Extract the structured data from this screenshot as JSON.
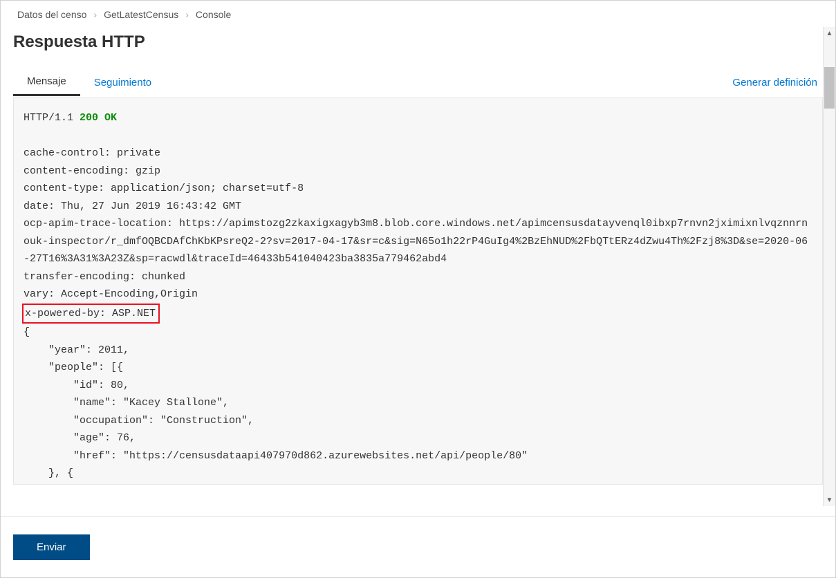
{
  "breadcrumb": {
    "item1": "Datos del censo",
    "item2": "GetLatestCensus",
    "item3": "Console"
  },
  "pageTitle": "Respuesta HTTP",
  "tabs": {
    "message": "Mensaje",
    "tracking": "Seguimiento",
    "generate": "Generar definición"
  },
  "response": {
    "protocol": "HTTP/1.1",
    "status": "200 OK",
    "headers": {
      "cacheControl": "cache-control: private",
      "contentEncoding": "content-encoding: gzip",
      "contentType": "content-type: application/json; charset=utf-8",
      "date": "date: Thu, 27 Jun 2019 16:43:42 GMT",
      "ocpApimTrace": "ocp-apim-trace-location: https://apimstozg2zkaxigxagyb3m8.blob.core.windows.net/apimcensusdatayvenql0ibxp7rnvn2jximixnlvqznnrnouk-inspector/r_dmfOQBCDAfChKbKPsreQ2-2?sv=2017-04-17&sr=c&sig=N65o1h22rP4GuIg4%2BzEhNUD%2FbQTtERz4dZwu4Th%2Fzj8%3D&se=2020-06-27T16%3A31%3A23Z&sp=racwdl&traceId=46433b541040423ba3835a779462abd4",
      "transferEncoding": "transfer-encoding: chunked",
      "vary": "vary: Accept-Encoding,Origin",
      "xPoweredBy": "x-powered-by: ASP.NET"
    },
    "body": "{\n    \"year\": 2011,\n    \"people\": [{\n        \"id\": 80,\n        \"name\": \"Kacey Stallone\",\n        \"occupation\": \"Construction\",\n        \"age\": 76,\n        \"href\": \"https://censusdataapi407970d862.azurewebsites.net/api/people/80\"\n    }, {"
  },
  "sendButton": "Enviar"
}
